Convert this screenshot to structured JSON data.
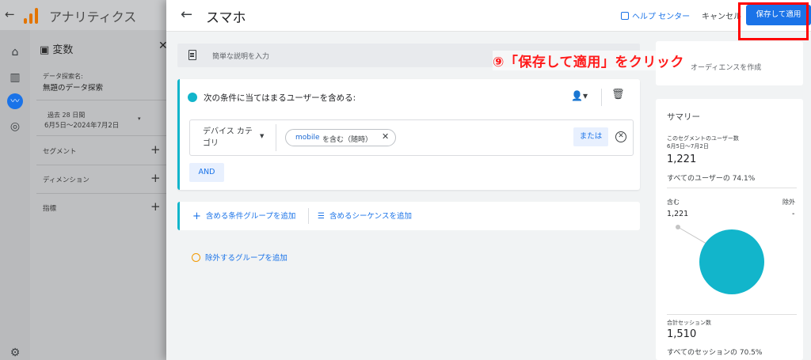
{
  "background": {
    "back_symbol": "←",
    "app_title": "アナリティクス",
    "panel_title": "変数",
    "close_symbol": "✕",
    "exploration_label": "データ探索名:",
    "exploration_name": "無題のデータ探索",
    "date_label": "過去 28 日間",
    "date_range": "6月5日～2024年7月2日",
    "sections": [
      {
        "label": "セグメント"
      },
      {
        "label": "ディメンション"
      },
      {
        "label": "指標"
      }
    ],
    "rail_icons": [
      "home-icon",
      "reports-icon",
      "explore-icon",
      "advertising-icon",
      "settings-icon"
    ],
    "brand_color": "#e37400"
  },
  "modal": {
    "title": "スマホ",
    "back_symbol": "←",
    "help_label": "ヘルプ センター",
    "cancel_label": "キャンセル",
    "save_label": "保存して適用",
    "description_placeholder": "簡単な説明を入力",
    "condition_title": "次の条件に当てはまるユーザーを含める:",
    "dimension_label": "デバイス カテゴリ",
    "chip_keyword": "mobile",
    "chip_rest": "を含む（随時）",
    "or_label": "または",
    "and_label": "AND",
    "add_group_label": "含める条件グループを追加",
    "add_sequence_label": "含めるシーケンスを追加",
    "exclude_label": "除外するグループを追加",
    "right_top_partial": "オーディエンスを作成",
    "accent_color": "#1a73e8",
    "teal_color": "#12b5cb"
  },
  "summary": {
    "title": "サマリー",
    "users_label": "このセグメントのユーザー数",
    "users_dates": "6月5日～7月2日",
    "users_value": "1,221",
    "users_pct": "すべてのユーザーの 74.1%",
    "include_label": "含む",
    "include_value": "1,221",
    "exclude_label": "除外",
    "exclude_value": "-",
    "sessions_label": "合計セッション数",
    "sessions_value": "1,510",
    "sessions_pct": "すべてのセッションの 70.5%"
  },
  "annotation": {
    "callout_text": "⑨「保存して適用」をクリック",
    "color": "#ff0000"
  }
}
